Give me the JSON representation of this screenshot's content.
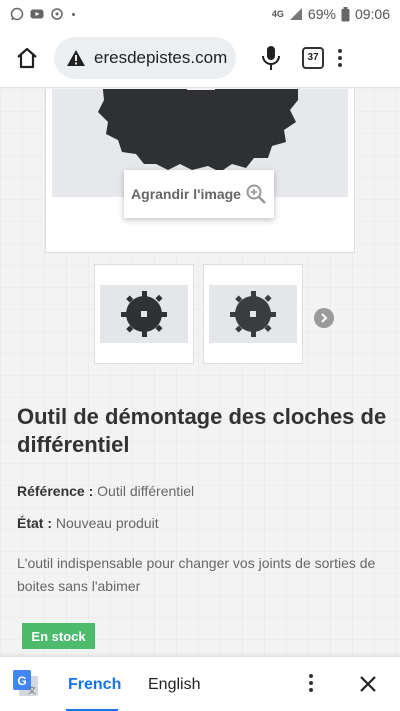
{
  "status_bar": {
    "network": "4G",
    "battery": "69%",
    "time": "09:06"
  },
  "browser": {
    "url": "eresdepistes.com",
    "tab_count": "37"
  },
  "product": {
    "enlarge_label": "Agrandir l'image",
    "title": "Outil de démontage des cloches de différentiel",
    "reference_label": "Référence :",
    "reference_value": "Outil différentiel",
    "state_label": "État :",
    "state_value": "Nouveau produit",
    "description": "L'outil indispensable pour changer vos joints de sorties de boites sans l'abimer",
    "stock": "En stock"
  },
  "translate_bar": {
    "source_lang": "French",
    "target_lang": "English"
  },
  "colors": {
    "accent": "#1a73e8",
    "stock_green": "#4cbb6c"
  }
}
